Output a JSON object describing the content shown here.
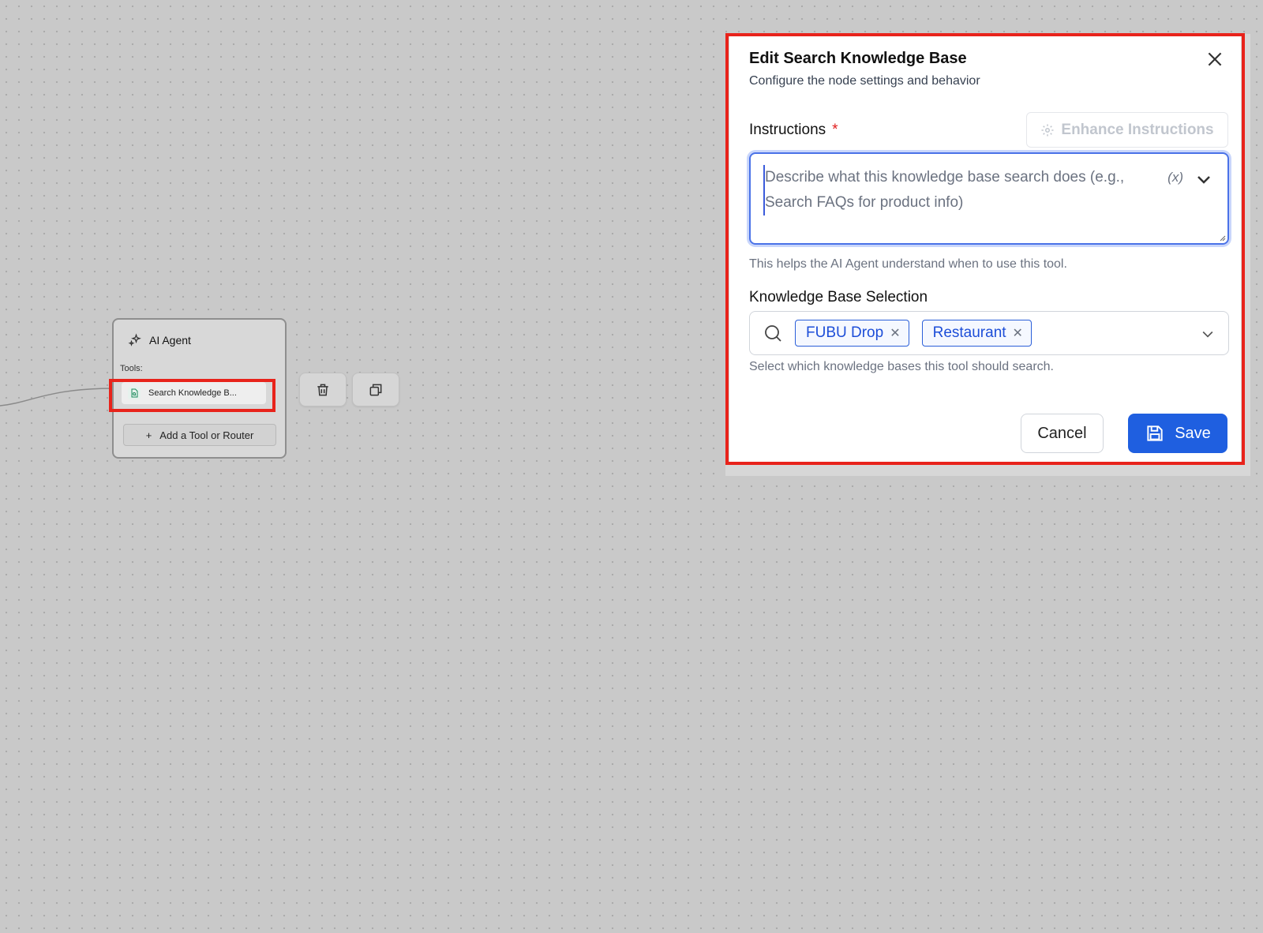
{
  "canvas": {
    "agent_node": {
      "title": "AI Agent",
      "tools_label": "Tools:",
      "tool_item_label": "Search Knowledge B...",
      "add_button_label": "Add a Tool or Router"
    },
    "node_actions": [
      "delete",
      "duplicate"
    ]
  },
  "dialog": {
    "title": "Edit Search Knowledge Base",
    "subtitle": "Configure the node settings and behavior",
    "instructions": {
      "label": "Instructions",
      "required_mark": "*",
      "enhance_label": "Enhance Instructions",
      "placeholder": "Describe what this knowledge base search does (e.g., Search FAQs for product info)",
      "variable_icon": "(x)",
      "help": "This helps the AI Agent understand when to use this tool."
    },
    "knowledge_base": {
      "label": "Knowledge Base Selection",
      "tags": [
        "FUBU Drop",
        "Restaurant"
      ],
      "help": "Select which knowledge bases this tool should search."
    },
    "cancel_label": "Cancel",
    "save_label": "Save"
  },
  "colors": {
    "primary": "#1f5fe0",
    "highlight": "#e8231b",
    "canvas": "#c9c9c9"
  }
}
